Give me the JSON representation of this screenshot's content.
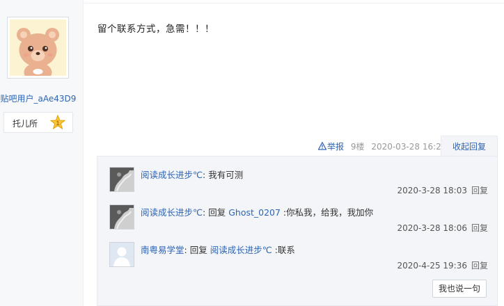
{
  "user": {
    "username": "贴吧用户_aAe43D9",
    "level_name": "托儿所",
    "level_number": "1"
  },
  "post": {
    "content": "留个联系方式，急需！！！",
    "report_label": "举报",
    "floor": "9楼",
    "time": "2020-03-28 16:20",
    "collapse_label": "收起回复"
  },
  "replies": [
    {
      "author": "阅读成长进步℃",
      "text": ": 我有可测",
      "time": "2020-3-28 18:03",
      "reply_label": "回复"
    },
    {
      "author": "阅读成长进步℃",
      "prefix": ": 回复 ",
      "target": "Ghost_0207",
      "text": " :你私我，给我，我加你",
      "time": "2020-3-28 18:06",
      "reply_label": "回复"
    },
    {
      "author": "南粤易学堂",
      "prefix": ": 回复 ",
      "target": "阅读成长进步℃",
      "text": " :联系",
      "time": "2020-4-25 19:36",
      "reply_label": "回复"
    }
  ],
  "say_button_label": "我也说一句",
  "colors": {
    "link": "#2d64b3",
    "panel": "#f3f5f8",
    "sidebar": "#f7f8fa"
  }
}
